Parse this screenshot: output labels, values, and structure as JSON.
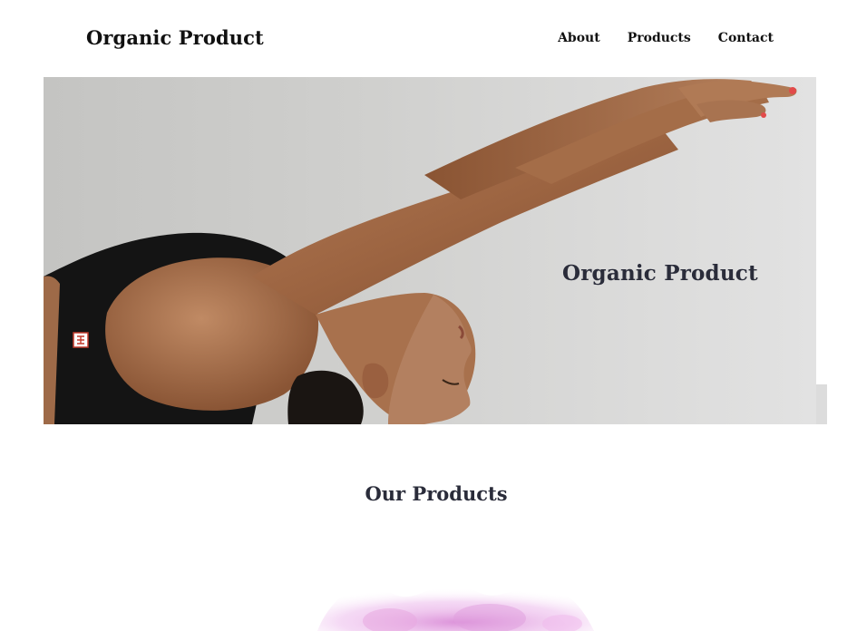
{
  "header": {
    "brand": "Organic Product",
    "nav": [
      {
        "label": "About"
      },
      {
        "label": "Products"
      },
      {
        "label": "Contact"
      }
    ]
  },
  "hero": {
    "title": "Organic Product",
    "image": "woman-stretching-yoga-photo"
  },
  "products": {
    "title": "Our Products",
    "decoration": "pink-watercolor-splash"
  },
  "colors": {
    "heading": "#2a2c3a",
    "text": "#111111",
    "hero_bg": "#d4d4d2",
    "watercolor": "#e8a8e0"
  }
}
